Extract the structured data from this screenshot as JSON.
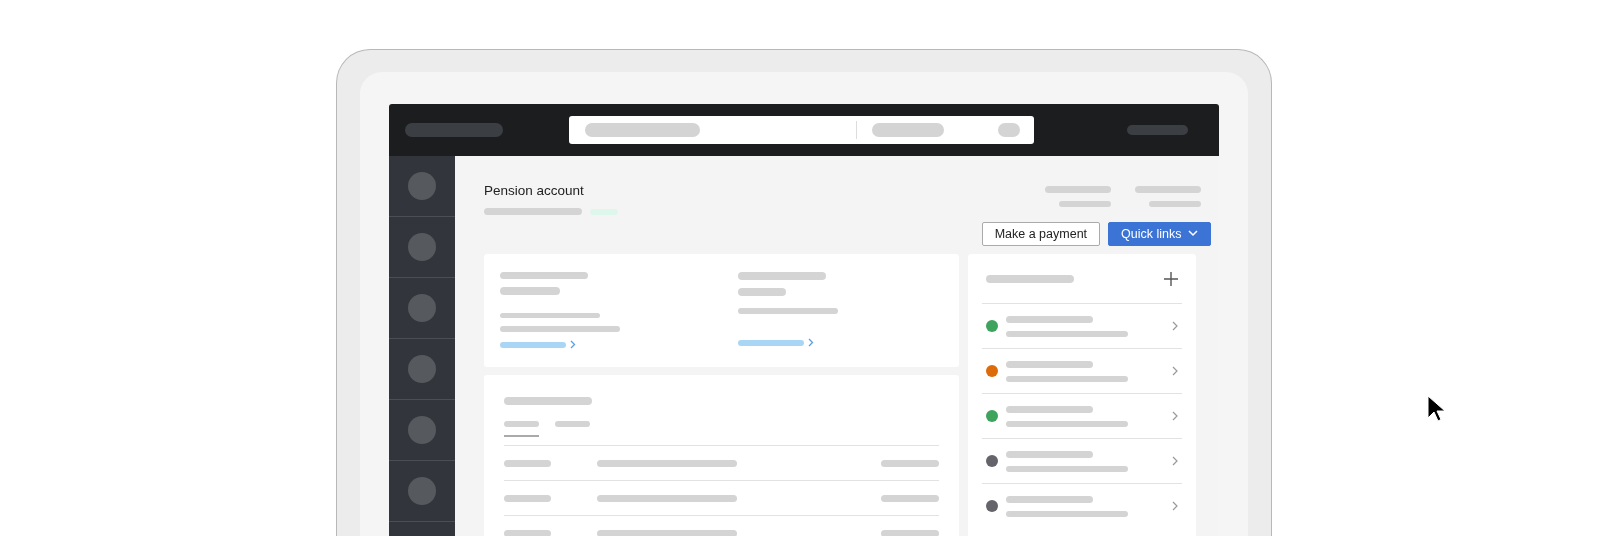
{
  "page_title": "Pension account",
  "buttons": [
    {
      "label": "Make a payment",
      "kind": "outline"
    },
    {
      "label": "Quick links",
      "kind": "primary"
    }
  ],
  "accounts_list": [
    {
      "color": "#3da35d"
    },
    {
      "color": "#dd6b0a"
    },
    {
      "color": "#3da35d"
    },
    {
      "color": "#65646b"
    },
    {
      "color": "#65646b"
    }
  ]
}
